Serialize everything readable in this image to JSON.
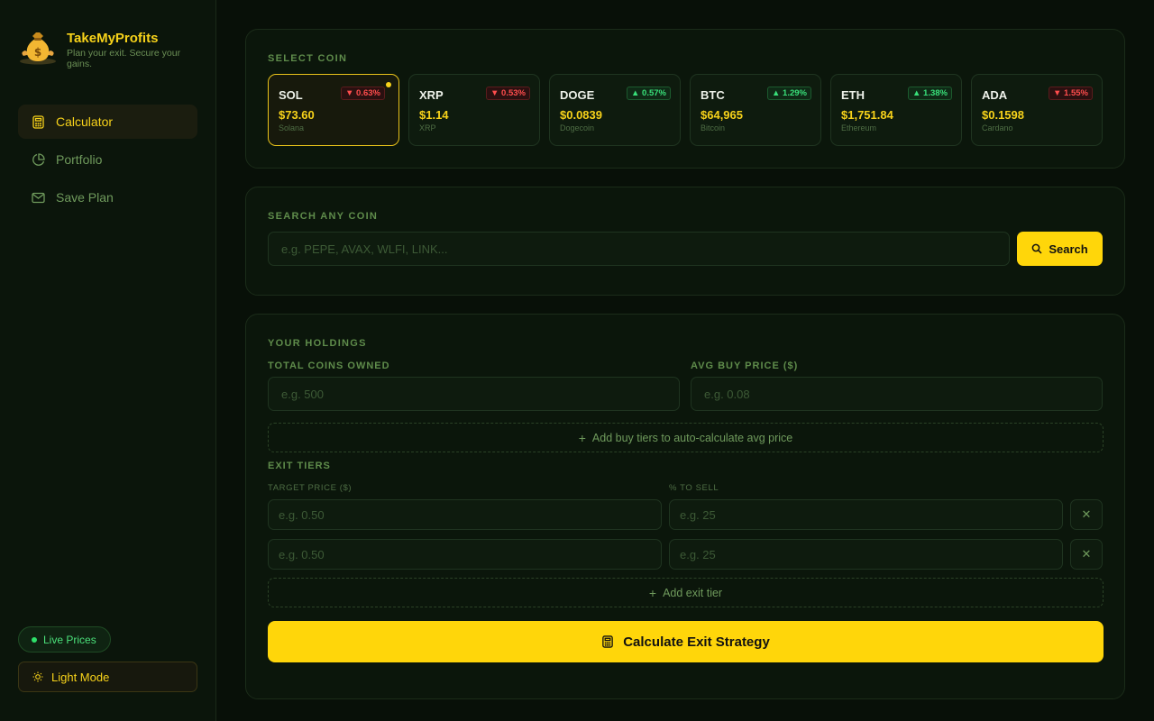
{
  "brand": {
    "title": "TakeMyProfits",
    "tagline": "Plan your exit. Secure your gains.",
    "logo_icon": "money-bag-icon"
  },
  "sidebar": {
    "items": [
      {
        "label": "Calculator",
        "icon": "calculator-icon",
        "active": true
      },
      {
        "label": "Portfolio",
        "icon": "pie-chart-icon",
        "active": false
      },
      {
        "label": "Save Plan",
        "icon": "mail-icon",
        "active": false
      }
    ],
    "live_label": "Live Prices",
    "theme_label": "Light Mode"
  },
  "select_coin": {
    "label": "SELECT COIN",
    "coins": [
      {
        "symbol": "SOL",
        "price": "$73.60",
        "name": "Solana",
        "change": "▼ 0.63%",
        "dir": "down",
        "selected": true
      },
      {
        "symbol": "XRP",
        "price": "$1.14",
        "name": "XRP",
        "change": "▼ 0.53%",
        "dir": "down",
        "selected": false
      },
      {
        "symbol": "DOGE",
        "price": "$0.0839",
        "name": "Dogecoin",
        "change": "▲ 0.57%",
        "dir": "up",
        "selected": false
      },
      {
        "symbol": "BTC",
        "price": "$64,965",
        "name": "Bitcoin",
        "change": "▲ 1.29%",
        "dir": "up",
        "selected": false
      },
      {
        "symbol": "ETH",
        "price": "$1,751.84",
        "name": "Ethereum",
        "change": "▲ 1.38%",
        "dir": "up",
        "selected": false
      },
      {
        "symbol": "ADA",
        "price": "$0.1598",
        "name": "Cardano",
        "change": "▼ 1.55%",
        "dir": "down",
        "selected": false
      }
    ]
  },
  "search": {
    "label": "SEARCH ANY COIN",
    "placeholder": "e.g. PEPE, AVAX, WLFI, LINK...",
    "button_label": "Search"
  },
  "holdings": {
    "label": "YOUR HOLDINGS",
    "coins_label": "TOTAL COINS OWNED",
    "coins_placeholder": "e.g. 500",
    "avg_label": "AVG BUY PRICE ($)",
    "avg_placeholder": "e.g. 0.08",
    "add_buy_tiers": "Add buy tiers to auto-calculate avg price"
  },
  "exit_tiers": {
    "label": "EXIT TIERS",
    "target_label": "TARGET PRICE ($)",
    "sell_label": "% TO SELL",
    "rows": [
      {
        "target_placeholder": "e.g. 0.50",
        "sell_placeholder": "e.g. 25"
      },
      {
        "target_placeholder": "e.g. 0.50",
        "sell_placeholder": "e.g. 25"
      }
    ],
    "add_label": "Add exit tier"
  },
  "calculate_label": "Calculate Exit Strategy",
  "colors": {
    "accent": "#ffd60a",
    "background": "#081008",
    "up": "#39e07a",
    "down": "#ff4d4d"
  }
}
